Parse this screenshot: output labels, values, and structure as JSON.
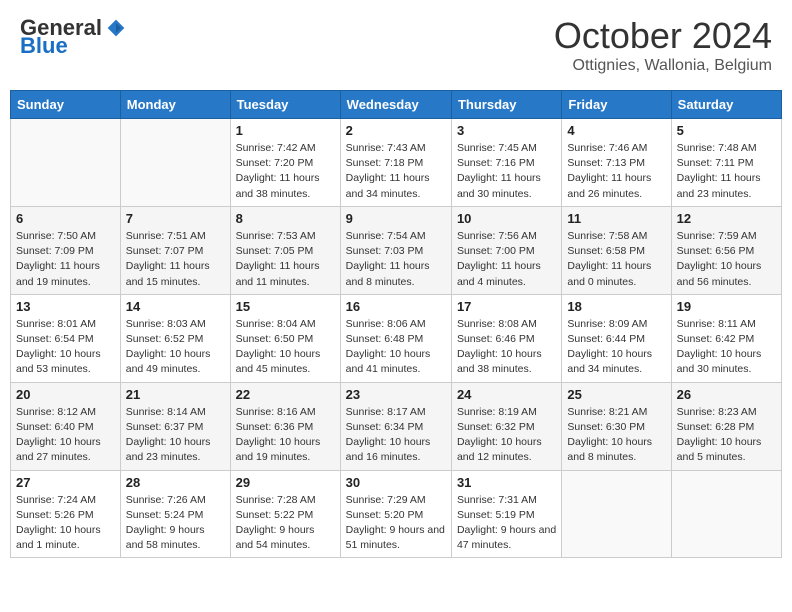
{
  "header": {
    "logo_general": "General",
    "logo_blue": "Blue",
    "month_title": "October 2024",
    "subtitle": "Ottignies, Wallonia, Belgium"
  },
  "days_of_week": [
    "Sunday",
    "Monday",
    "Tuesday",
    "Wednesday",
    "Thursday",
    "Friday",
    "Saturday"
  ],
  "weeks": [
    [
      {
        "day": "",
        "info": ""
      },
      {
        "day": "",
        "info": ""
      },
      {
        "day": "1",
        "info": "Sunrise: 7:42 AM\nSunset: 7:20 PM\nDaylight: 11 hours and 38 minutes."
      },
      {
        "day": "2",
        "info": "Sunrise: 7:43 AM\nSunset: 7:18 PM\nDaylight: 11 hours and 34 minutes."
      },
      {
        "day": "3",
        "info": "Sunrise: 7:45 AM\nSunset: 7:16 PM\nDaylight: 11 hours and 30 minutes."
      },
      {
        "day": "4",
        "info": "Sunrise: 7:46 AM\nSunset: 7:13 PM\nDaylight: 11 hours and 26 minutes."
      },
      {
        "day": "5",
        "info": "Sunrise: 7:48 AM\nSunset: 7:11 PM\nDaylight: 11 hours and 23 minutes."
      }
    ],
    [
      {
        "day": "6",
        "info": "Sunrise: 7:50 AM\nSunset: 7:09 PM\nDaylight: 11 hours and 19 minutes."
      },
      {
        "day": "7",
        "info": "Sunrise: 7:51 AM\nSunset: 7:07 PM\nDaylight: 11 hours and 15 minutes."
      },
      {
        "day": "8",
        "info": "Sunrise: 7:53 AM\nSunset: 7:05 PM\nDaylight: 11 hours and 11 minutes."
      },
      {
        "day": "9",
        "info": "Sunrise: 7:54 AM\nSunset: 7:03 PM\nDaylight: 11 hours and 8 minutes."
      },
      {
        "day": "10",
        "info": "Sunrise: 7:56 AM\nSunset: 7:00 PM\nDaylight: 11 hours and 4 minutes."
      },
      {
        "day": "11",
        "info": "Sunrise: 7:58 AM\nSunset: 6:58 PM\nDaylight: 11 hours and 0 minutes."
      },
      {
        "day": "12",
        "info": "Sunrise: 7:59 AM\nSunset: 6:56 PM\nDaylight: 10 hours and 56 minutes."
      }
    ],
    [
      {
        "day": "13",
        "info": "Sunrise: 8:01 AM\nSunset: 6:54 PM\nDaylight: 10 hours and 53 minutes."
      },
      {
        "day": "14",
        "info": "Sunrise: 8:03 AM\nSunset: 6:52 PM\nDaylight: 10 hours and 49 minutes."
      },
      {
        "day": "15",
        "info": "Sunrise: 8:04 AM\nSunset: 6:50 PM\nDaylight: 10 hours and 45 minutes."
      },
      {
        "day": "16",
        "info": "Sunrise: 8:06 AM\nSunset: 6:48 PM\nDaylight: 10 hours and 41 minutes."
      },
      {
        "day": "17",
        "info": "Sunrise: 8:08 AM\nSunset: 6:46 PM\nDaylight: 10 hours and 38 minutes."
      },
      {
        "day": "18",
        "info": "Sunrise: 8:09 AM\nSunset: 6:44 PM\nDaylight: 10 hours and 34 minutes."
      },
      {
        "day": "19",
        "info": "Sunrise: 8:11 AM\nSunset: 6:42 PM\nDaylight: 10 hours and 30 minutes."
      }
    ],
    [
      {
        "day": "20",
        "info": "Sunrise: 8:12 AM\nSunset: 6:40 PM\nDaylight: 10 hours and 27 minutes."
      },
      {
        "day": "21",
        "info": "Sunrise: 8:14 AM\nSunset: 6:37 PM\nDaylight: 10 hours and 23 minutes."
      },
      {
        "day": "22",
        "info": "Sunrise: 8:16 AM\nSunset: 6:36 PM\nDaylight: 10 hours and 19 minutes."
      },
      {
        "day": "23",
        "info": "Sunrise: 8:17 AM\nSunset: 6:34 PM\nDaylight: 10 hours and 16 minutes."
      },
      {
        "day": "24",
        "info": "Sunrise: 8:19 AM\nSunset: 6:32 PM\nDaylight: 10 hours and 12 minutes."
      },
      {
        "day": "25",
        "info": "Sunrise: 8:21 AM\nSunset: 6:30 PM\nDaylight: 10 hours and 8 minutes."
      },
      {
        "day": "26",
        "info": "Sunrise: 8:23 AM\nSunset: 6:28 PM\nDaylight: 10 hours and 5 minutes."
      }
    ],
    [
      {
        "day": "27",
        "info": "Sunrise: 7:24 AM\nSunset: 5:26 PM\nDaylight: 10 hours and 1 minute."
      },
      {
        "day": "28",
        "info": "Sunrise: 7:26 AM\nSunset: 5:24 PM\nDaylight: 9 hours and 58 minutes."
      },
      {
        "day": "29",
        "info": "Sunrise: 7:28 AM\nSunset: 5:22 PM\nDaylight: 9 hours and 54 minutes."
      },
      {
        "day": "30",
        "info": "Sunrise: 7:29 AM\nSunset: 5:20 PM\nDaylight: 9 hours and 51 minutes."
      },
      {
        "day": "31",
        "info": "Sunrise: 7:31 AM\nSunset: 5:19 PM\nDaylight: 9 hours and 47 minutes."
      },
      {
        "day": "",
        "info": ""
      },
      {
        "day": "",
        "info": ""
      }
    ]
  ]
}
